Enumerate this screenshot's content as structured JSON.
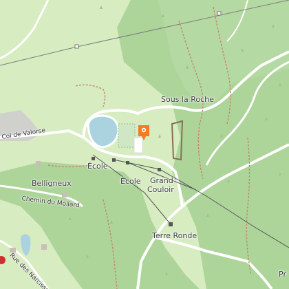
{
  "map": {
    "labels": {
      "sous_la_roche": "Sous la Roche",
      "col_de_valorse": "Col de Valorse",
      "ecole_1": "École",
      "ecole_2": "École",
      "grand_couloir_1": "Grand",
      "grand_couloir_2": "Couloir",
      "belligneux": "Belligneux",
      "chemin_du_mollard": "Chemin du Mollard",
      "terre_ronde": "Terre Ronde",
      "rue_des_narcisses": "Rue des Narcisses",
      "pr_partial": "Pr"
    },
    "marker": {
      "icon": "ski-lift-marker-icon",
      "color": "#f47b20"
    },
    "colors": {
      "grassland": "#d7ecc0",
      "forest": "#add59a",
      "water": "#aad3df",
      "road": "#ffffff",
      "path": "#c08a6b",
      "aerialway": "#7d7d7d"
    }
  }
}
